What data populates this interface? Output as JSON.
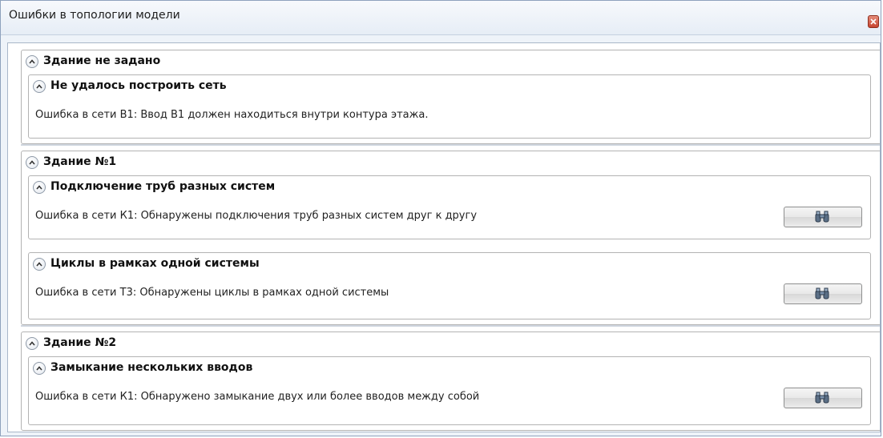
{
  "window": {
    "title": "Ошибки в топологии модели"
  },
  "groups": [
    {
      "header": "Здание не задано",
      "errors": [
        {
          "title": "Не удалось построить сеть",
          "message": "Ошибка в сети В1: Ввод В1 должен находиться внутри контура этажа.",
          "has_find_button": false
        }
      ]
    },
    {
      "header": "Здание №1",
      "errors": [
        {
          "title": "Подключение труб разных систем",
          "message": "Ошибка в сети К1: Обнаружены подключения труб разных систем друг к другу",
          "has_find_button": true
        },
        {
          "title": "Циклы в рамках одной системы",
          "message": "Ошибка в сети Т3: Обнаружены циклы в рамках одной системы",
          "has_find_button": true
        }
      ]
    },
    {
      "header": "Здание №2",
      "errors": [
        {
          "title": "Замыкание нескольких вводов",
          "message": "Ошибка в сети К1: Обнаружено замыкание двух или более вводов между собой",
          "has_find_button": true
        }
      ]
    }
  ],
  "icons": {
    "close": "close-icon",
    "collapse": "chevron-up-icon",
    "find": "binoculars-icon"
  },
  "colors": {
    "close_button": "#c74530",
    "border": "#b3b3b3",
    "titlebar": "#e6edf6"
  }
}
